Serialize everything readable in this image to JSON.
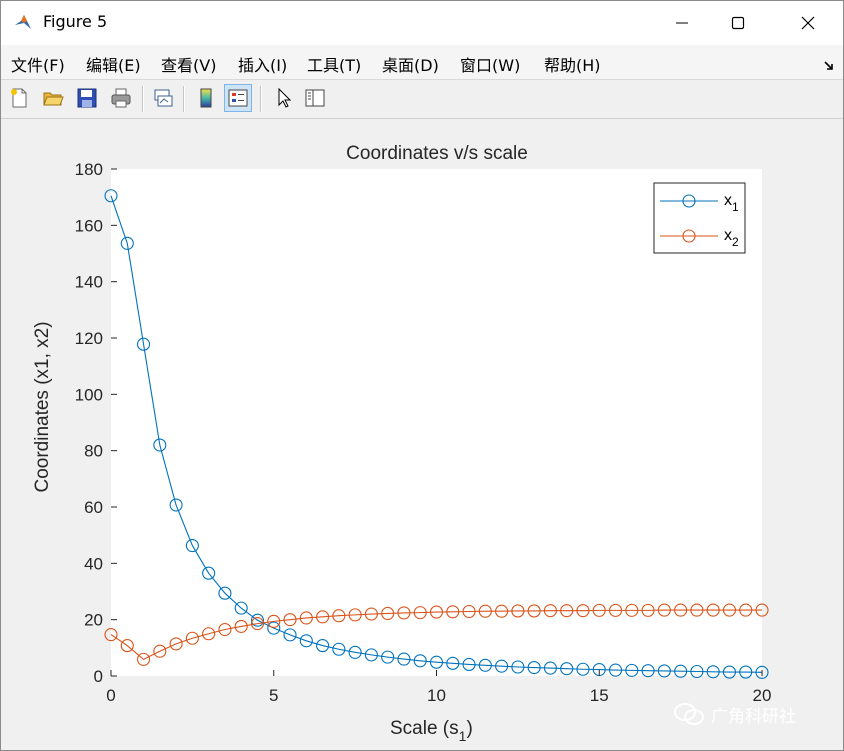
{
  "window": {
    "title": "Figure 5",
    "controls": [
      "minimize",
      "maximize",
      "close"
    ]
  },
  "menu": [
    {
      "label": "文件(F)"
    },
    {
      "label": "编辑(E)"
    },
    {
      "label": "查看(V)"
    },
    {
      "label": "插入(I)"
    },
    {
      "label": "工具(T)"
    },
    {
      "label": "桌面(D)"
    },
    {
      "label": "窗口(W)"
    },
    {
      "label": "帮助(H)"
    }
  ],
  "toolbar": {
    "buttons": [
      "new-figure-icon",
      "open-file-icon",
      "save-icon",
      "print-icon",
      "link-plot-icon",
      "colorbar-icon",
      "legend-icon",
      "pointer-icon",
      "property-editor-icon"
    ],
    "active": "legend-icon"
  },
  "colors": {
    "series1": "#0072BD",
    "series2": "#D95319"
  },
  "chart_data": {
    "type": "line",
    "title": "Coordinates v/s scale",
    "xlabel_main": "Scale (s",
    "xlabel_sub": "1",
    "xlabel_end": ")",
    "ylabel": "Coordinates (x1, x2)",
    "xlim": [
      0,
      20
    ],
    "ylim": [
      0,
      180
    ],
    "xticks": [
      "0",
      "5",
      "10",
      "15",
      "20"
    ],
    "yticks": [
      "0",
      "20",
      "40",
      "60",
      "80",
      "100",
      "120",
      "140",
      "160",
      "180"
    ],
    "legend_position": "top-right",
    "grid": false,
    "x": [
      0,
      0.5,
      1,
      1.5,
      2,
      2.5,
      3,
      3.5,
      4,
      4.5,
      5,
      5.5,
      6,
      6.5,
      7,
      7.5,
      8,
      8.5,
      9,
      9.5,
      10,
      10.5,
      11,
      11.5,
      12,
      12.5,
      13,
      13.5,
      14,
      14.5,
      15,
      15.5,
      16,
      16.5,
      17,
      17.5,
      18,
      18.5,
      19,
      19.5,
      20
    ],
    "series": [
      {
        "name": "x",
        "sub": "1",
        "color": "#0072BD",
        "values": [
          170.5,
          153.6,
          117.8,
          82.0,
          60.7,
          46.3,
          36.5,
          29.4,
          24.1,
          19.8,
          17.0,
          14.6,
          12.5,
          10.8,
          9.5,
          8.4,
          7.5,
          6.7,
          6.0,
          5.4,
          4.9,
          4.5,
          4.1,
          3.8,
          3.5,
          3.2,
          3.0,
          2.8,
          2.6,
          2.4,
          2.3,
          2.1,
          2.0,
          1.9,
          1.8,
          1.7,
          1.6,
          1.5,
          1.4,
          1.4,
          1.3
        ]
      },
      {
        "name": "x",
        "sub": "2",
        "color": "#D95319",
        "values": [
          14.7,
          10.8,
          5.9,
          8.8,
          11.4,
          13.4,
          15.0,
          16.5,
          17.6,
          18.6,
          19.4,
          20.0,
          20.6,
          21.0,
          21.4,
          21.7,
          22.0,
          22.2,
          22.4,
          22.5,
          22.7,
          22.8,
          22.9,
          23.0,
          23.0,
          23.1,
          23.1,
          23.2,
          23.2,
          23.2,
          23.3,
          23.3,
          23.3,
          23.3,
          23.4,
          23.4,
          23.4,
          23.4,
          23.4,
          23.4,
          23.4
        ]
      }
    ]
  },
  "watermark": {
    "text": "广角科研社"
  }
}
